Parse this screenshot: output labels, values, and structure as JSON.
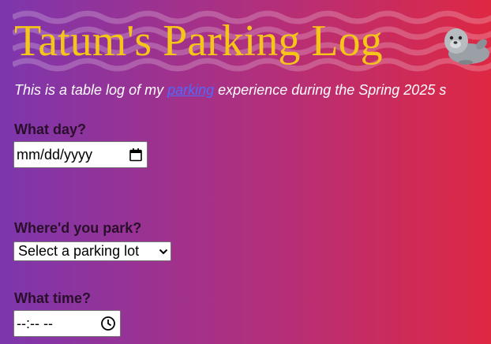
{
  "page": {
    "title": "Tatum's Parking Log",
    "intro": {
      "before": "This is a table log of my ",
      "link": "parking",
      "after": " experience during the Spring 2025 s"
    }
  },
  "form": {
    "day": {
      "label": "What day?",
      "value": "mm/dd/yyyy"
    },
    "lot": {
      "label": "Where'd you park?",
      "selected": "Select a parking lot"
    },
    "time": {
      "label": "What time?",
      "value": "--:-- --"
    }
  },
  "icons": {
    "header_decoration": "seal-icon",
    "date_picker": "calendar-icon",
    "dropdown": "chevron-down-icon",
    "time_picker": "clock-icon"
  },
  "colors": {
    "title": "#f5c518",
    "link": "#4d6bff",
    "gradient_start": "#7d36ad",
    "gradient_end": "#de2843"
  }
}
